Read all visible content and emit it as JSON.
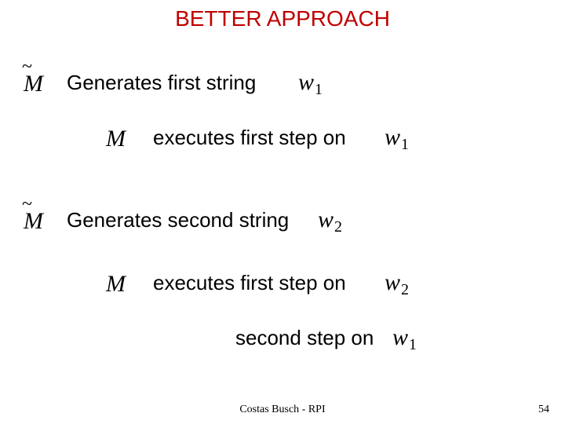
{
  "title": "BETTER APPROACH",
  "symbols": {
    "Mtilde": "M",
    "M": "M",
    "w1_base": "w",
    "w1_sub": "1",
    "w2_base": "w",
    "w2_sub": "2"
  },
  "lines": {
    "gen_first": "Generates first string",
    "exec_first_on": "executes first step on",
    "gen_second": "Generates second string",
    "exec_first_on_2": "executes first step on",
    "second_step_on": "second step on"
  },
  "footer": {
    "center": "Costas Busch - RPI",
    "page": "54"
  }
}
